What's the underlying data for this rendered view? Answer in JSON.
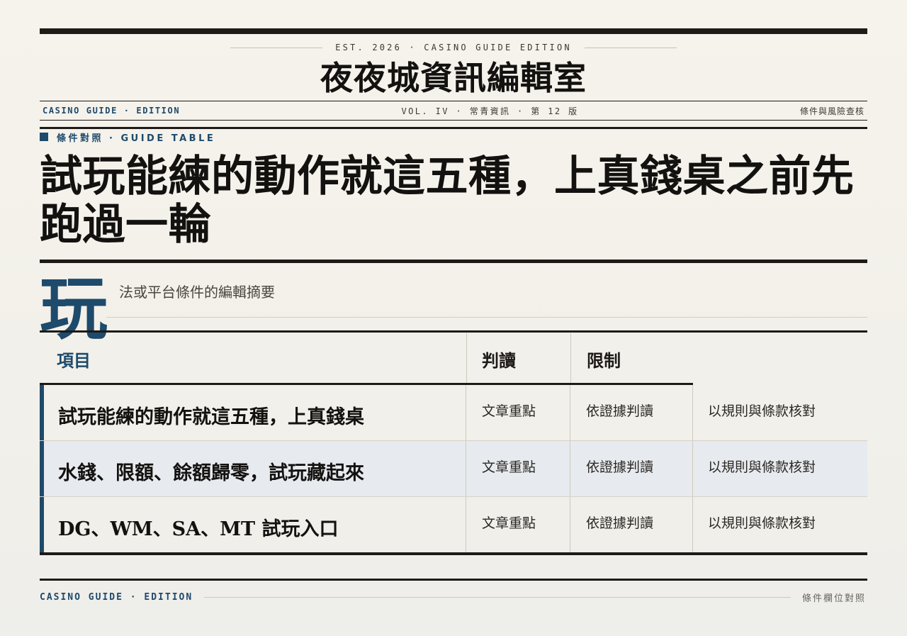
{
  "masthead": {
    "est_line": "EST. 2026 · CASINO GUIDE EDITION",
    "title": "夜夜城資訊編輯室",
    "left": "CASINO GUIDE · EDITION",
    "center": "VOL. IV · 常青資訊 · 第 12 版",
    "right": "條件與風險查核"
  },
  "kicker": "條件對照 · GUIDE TABLE",
  "headline": "試玩能練的動作就這五種，上真錢桌之前先跑過一輪",
  "dropcap": "玩",
  "deck": "法或平台條件的編輯摘要",
  "table": {
    "headers": [
      "項目",
      "判讀",
      "限制"
    ],
    "rows": [
      {
        "item": "試玩能練的動作就這五種，上真錢桌",
        "c1": "文章重點",
        "c2": "依證據判讀",
        "c3": "以規則與條款核對"
      },
      {
        "item": "水錢、限額、餘額歸零，試玩藏起來",
        "c1": "文章重點",
        "c2": "依證據判讀",
        "c3": "以規則與條款核對"
      },
      {
        "item": "DG、WM、SA、MT 試玩入口",
        "c1": "文章重點",
        "c2": "依證據判讀",
        "c3": "以規則與條款核對"
      }
    ]
  },
  "footer": {
    "left": "CASINO GUIDE · EDITION",
    "right": "條件欄位對照"
  },
  "colors": {
    "accent": "#1e4a6b",
    "ink": "#1d1a17",
    "alt_row": "#e7ebef"
  }
}
